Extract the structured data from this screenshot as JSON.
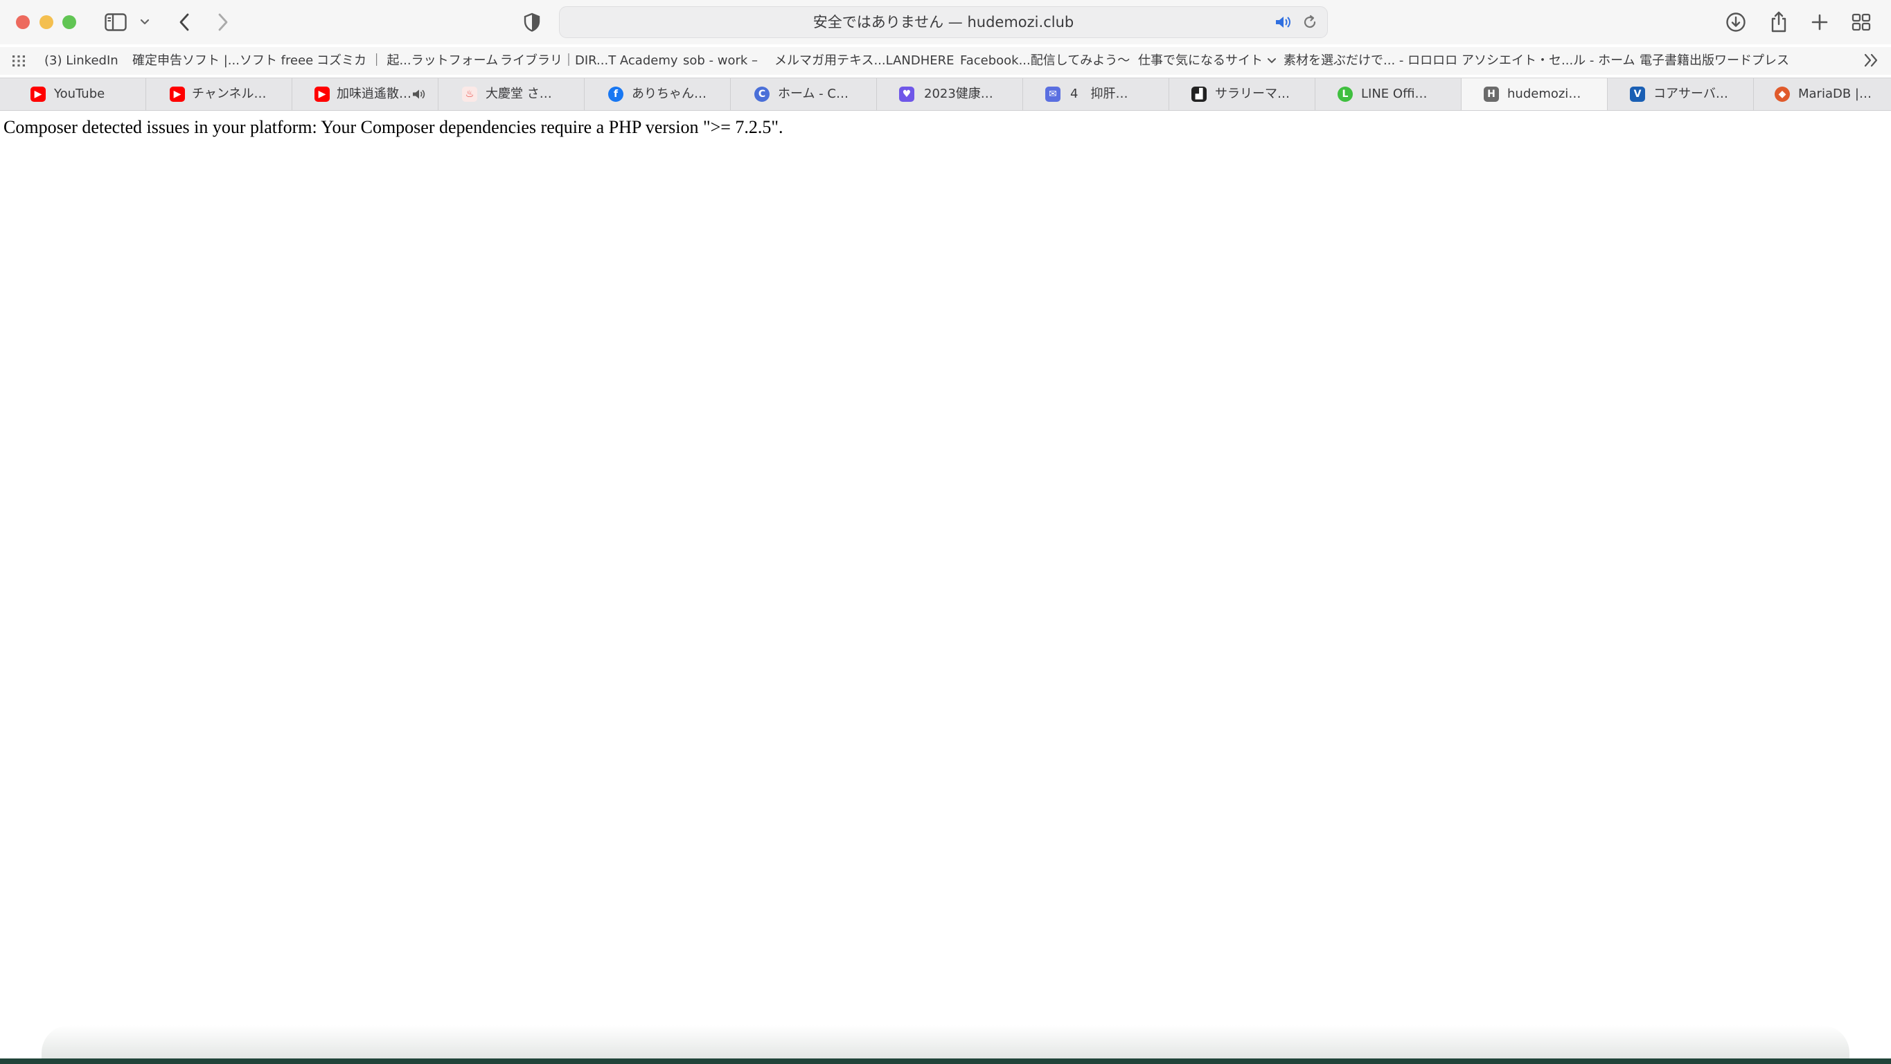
{
  "address_bar": {
    "text": "安全ではありません — hudemozi.club"
  },
  "bookmarks": [
    {
      "label": "(3) LinkedIn"
    },
    {
      "label": "確定申告ソフト |...ソフト freee"
    },
    {
      "label": "コズミカ ｜ 起...ラットフォーム"
    },
    {
      "label": "ライブラリ｜DIR...T Academy"
    },
    {
      "label": "sob - work –"
    },
    {
      "label": "メルマガ用テキス...LANDHERE"
    },
    {
      "label": "Facebook...配信してみよう〜"
    },
    {
      "label": "仕事で気になるサイト"
    },
    {
      "label": "素材を選ぶだけで... - ロロロロ"
    },
    {
      "label": "アソシエイト・セ...ル - ホーム"
    },
    {
      "label": "電子書籍出版ワードプレス"
    }
  ],
  "tabs": [
    {
      "title": "YouTube",
      "icon": "youtube-icon",
      "color": "#ff0000"
    },
    {
      "title": "チャンネル…",
      "icon": "youtube-icon",
      "color": "#ff0000"
    },
    {
      "title": "加味逍遙散…",
      "icon": "youtube-icon",
      "color": "#ff0000",
      "audio": true
    },
    {
      "title": "大慶堂 さ…",
      "icon": "daikeido-icon",
      "color": "#e8413c"
    },
    {
      "title": "ありちゃん…",
      "icon": "facebook-icon",
      "color": "#1877f2"
    },
    {
      "title": "ホーム - C…",
      "icon": "cosmica-icon",
      "color": "#4a6fd8"
    },
    {
      "title": "2023健康…",
      "icon": "chat-icon",
      "color": "#6f57e8"
    },
    {
      "title": "4　抑肝…",
      "icon": "chat-icon",
      "color": "#5a6fe0"
    },
    {
      "title": "サラリーマ…",
      "icon": "chart-icon",
      "color": "#222222"
    },
    {
      "title": "LINE Offi…",
      "icon": "line-icon",
      "color": "#3fbf3f"
    },
    {
      "title": "hudemozi…",
      "icon": "letter-h-icon",
      "color": "#6b6b6b",
      "active": true
    },
    {
      "title": "コアサーバ…",
      "icon": "coreserver-icon",
      "color": "#1a5fb4"
    },
    {
      "title": "MariaDB |…",
      "icon": "mariadb-icon",
      "color": "#e05a2b"
    }
  ],
  "page": {
    "error_text": "Composer detected issues in your platform: Your Composer dependencies require a PHP version \">= 7.2.5\"."
  },
  "colors": {
    "close": "#ed6a5e",
    "minimize": "#f4bf4f",
    "maximize": "#61c554",
    "audio_accent": "#2f6fe0"
  }
}
